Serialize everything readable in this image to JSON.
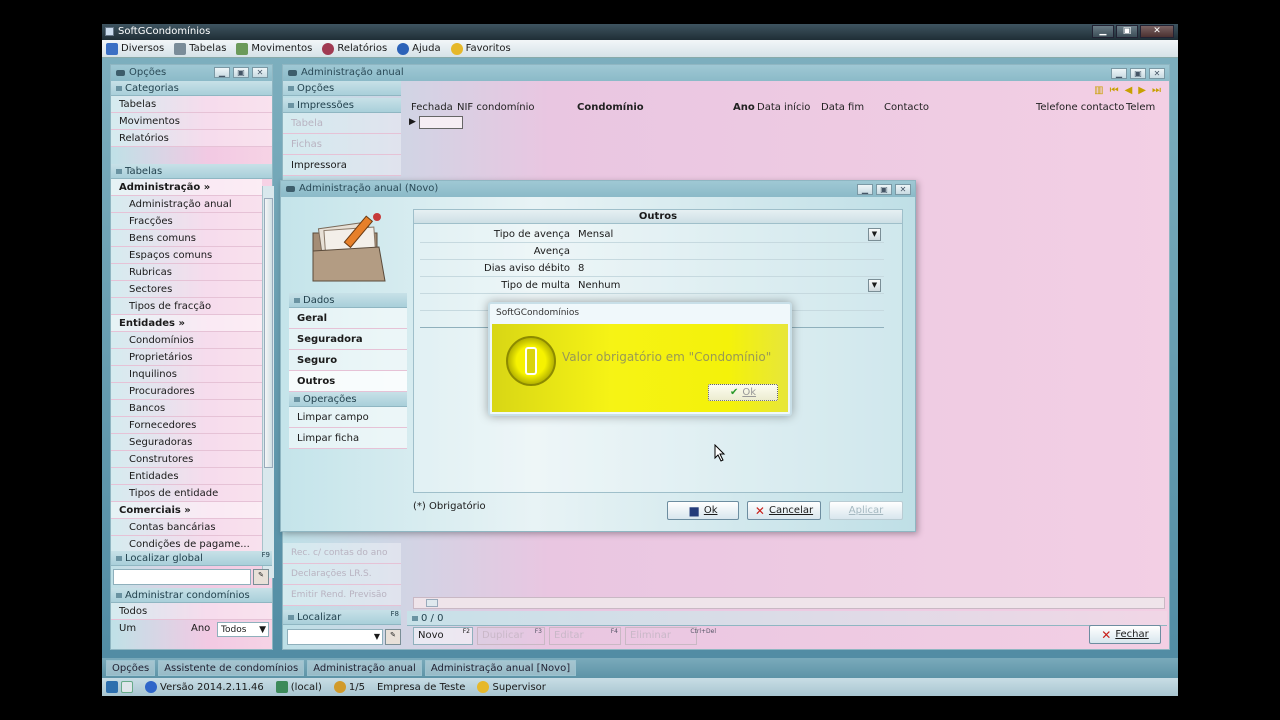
{
  "app": {
    "title": "SoftGCondomínios",
    "win_min": "▁",
    "win_max": "▣",
    "win_close": "✕"
  },
  "menu": {
    "items": [
      "Diversos",
      "Tabelas",
      "Movimentos",
      "Relatórios",
      "Ajuda",
      "Favoritos"
    ]
  },
  "left_panel": {
    "title": "Opções",
    "categories_head": "Categorias",
    "categories": [
      "Tabelas",
      "Movimentos",
      "Relatórios"
    ],
    "tables_head": "Tabelas",
    "tables": [
      {
        "label": "Administração »",
        "type": "group"
      },
      {
        "label": "Administração anual",
        "type": "sub"
      },
      {
        "label": "Fracções",
        "type": "sub"
      },
      {
        "label": "Bens comuns",
        "type": "sub"
      },
      {
        "label": "Espaços comuns",
        "type": "sub"
      },
      {
        "label": "Rubricas",
        "type": "sub"
      },
      {
        "label": "Sectores",
        "type": "sub"
      },
      {
        "label": "Tipos de fracção",
        "type": "sub"
      },
      {
        "label": "Entidades »",
        "type": "group"
      },
      {
        "label": "Condomínios",
        "type": "sub"
      },
      {
        "label": "Proprietários",
        "type": "sub"
      },
      {
        "label": "Inquilinos",
        "type": "sub"
      },
      {
        "label": "Procuradores",
        "type": "sub"
      },
      {
        "label": "Bancos",
        "type": "sub"
      },
      {
        "label": "Fornecedores",
        "type": "sub"
      },
      {
        "label": "Seguradoras",
        "type": "sub"
      },
      {
        "label": "Construtores",
        "type": "sub"
      },
      {
        "label": "Entidades",
        "type": "sub"
      },
      {
        "label": "Tipos de entidade",
        "type": "sub"
      },
      {
        "label": "Comerciais »",
        "type": "group"
      },
      {
        "label": "Contas bancárias",
        "type": "sub"
      },
      {
        "label": "Condições de pagame...",
        "type": "sub"
      }
    ],
    "localizar_global_head": "Localizar global",
    "localizar_global_key": "F9",
    "administrar_head": "Administrar condomínios",
    "administrar_item": "Todos",
    "um_label": "Um",
    "ano_label": "Ano",
    "ano_value": "Todos"
  },
  "main_window": {
    "title": "Administração anual",
    "opcoes_head": "Opções",
    "impressoes_head": "Impressões",
    "impressoes": [
      {
        "label": "Tabela",
        "disabled": true
      },
      {
        "label": "Fichas",
        "disabled": true
      },
      {
        "label": "Impressora",
        "disabled": false
      }
    ],
    "extra_items": [
      "Rec. c/ contas do ano",
      "Declarações LR.S.",
      "Emitir Rend. Previsão"
    ],
    "localizar_head": "Localizar",
    "localizar_key": "F8",
    "columns": [
      "Fechada",
      "NIF condomínio",
      "Condomínio",
      "Ano",
      "Data início",
      "Data fim",
      "Contacto",
      "Telefone contacto",
      "Telem"
    ],
    "record_count": "0 / 0",
    "nav": [
      "Novo",
      "Duplicar",
      "Editar",
      "Eliminar"
    ],
    "nav_keys": [
      "F2",
      "F3",
      "F4",
      "Ctrl+Del"
    ],
    "close_button": "Fechar"
  },
  "dialog": {
    "title": "Administração anual (Novo)",
    "section_title": "Outros",
    "rows": [
      {
        "label": "Tipo de avença",
        "value": "Mensal",
        "dropdown": true
      },
      {
        "label": "Avença",
        "value": "",
        "dropdown": false
      },
      {
        "label": "Dias aviso débito",
        "value": "8",
        "dropdown": false
      },
      {
        "label": "Tipo de multa",
        "value": "Nenhum",
        "dropdown": true
      }
    ],
    "dados_head": "Dados",
    "dados": [
      "Geral",
      "Seguradora",
      "Seguro",
      "Outros"
    ],
    "operacoes_head": "Operações",
    "operacoes": [
      "Limpar campo",
      "Limpar ficha"
    ],
    "required_note": "(*) Obrigatório",
    "ok_label": "Ok",
    "cancel_label": "Cancelar",
    "apply_label": "Aplicar"
  },
  "alert": {
    "title": "SoftGCondomínios",
    "message": "Valor obrigatório em \"Condomínio\"",
    "ok_label": "Ok"
  },
  "taskbar": [
    "Opções",
    "Assistente de condomínios",
    "Administração anual",
    "Administração anual [Novo]"
  ],
  "status": {
    "version": "Versão 2014.2.11.46",
    "location": "(local)",
    "users": "1/5",
    "company": "Empresa de Teste",
    "user": "Supervisor"
  },
  "colors": {
    "title_bar": "#1f2e36",
    "panel_pink": "#f2c9e3",
    "panel_teal": "#bfe1e7",
    "alert_yellow": "#f4f20a",
    "desktop": "#000000"
  }
}
